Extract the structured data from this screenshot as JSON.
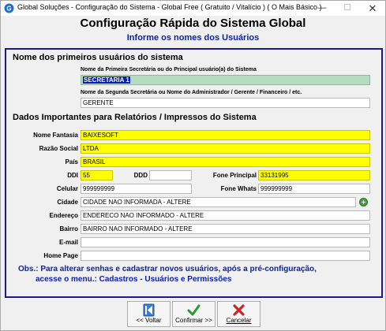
{
  "window": {
    "title": "Global Soluções - Configuração do Sistema - Global Free ( Gratuito / Vitalício ) ( O Mais Básico )",
    "minimize": "—",
    "maximize": "☐",
    "close": "✕"
  },
  "header": {
    "title": "Configuração Rápida do Sistema Global",
    "subtitle": "Informe os nomes dos Usuários"
  },
  "users_section": {
    "title": "Nome dos primeiros usuários do sistema",
    "first_label": "Nome da Primeira Secretária ou do Principal usuário(a) do Sistema",
    "first_value": "SECRETARIA 1",
    "second_label": "Nome da Segunda Secretária ou Nome do Administrador / Gerente  / Financeiro / etc.",
    "second_value": "GERENTE"
  },
  "report_section": {
    "title": "Dados Importantes para Relatórios / Impressos do Sistema",
    "nome_fantasia_label": "Nome Fantasia",
    "nome_fantasia_value": "BAIXESOFT",
    "razao_social_label": "Razão Social",
    "razao_social_value": "LTDA",
    "pais_label": "País",
    "pais_value": "BRASIL",
    "ddi_label": "DDI",
    "ddi_value": "55",
    "ddd_label": "DDD",
    "ddd_value": "",
    "fone_principal_label": "Fone Principal",
    "fone_principal_value": "33131995",
    "celular_label": "Celular",
    "celular_value": "999999999",
    "fone_whats_label": "Fone Whats",
    "fone_whats_value": "999999999",
    "cidade_label": "Cidade",
    "cidade_value": "CIDADE NAO INFORMADA - ALTERE",
    "endereco_label": "Endereço",
    "endereco_value": "ENDERECO NAO INFORMADO - ALTERE",
    "bairro_label": "Bairro",
    "bairro_value": "BAIRRO NAO INFORMADO - ALTERE",
    "email_label": "E-mail",
    "email_value": "",
    "homepage_label": "Home Page",
    "homepage_value": ""
  },
  "obs": {
    "line1": "Obs.: Para alterar senhas e cadastrar novos usuários, após a pré-configuração,",
    "line2": "acesse o menu.: Cadastros - Usuários e Permissões"
  },
  "buttons": {
    "voltar": "<< Voltar",
    "confirmar": "Confirmar >>",
    "cancelar": "Cancelar"
  },
  "colors": {
    "accent_blue": "#0a1fa8",
    "highlight_yellow": "#ffff00",
    "confirm_green": "#2a9a2a",
    "cancel_red": "#d42020"
  },
  "icons": {
    "app": "app-logo-icon",
    "add_city": "plus-circle-icon",
    "voltar": "back-arrow-icon",
    "confirmar": "checkmark-icon",
    "cancelar": "x-mark-icon"
  }
}
